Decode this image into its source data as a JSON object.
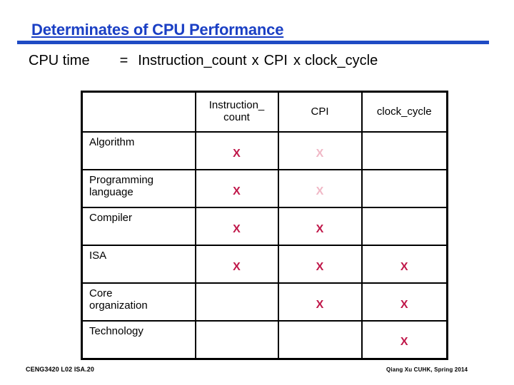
{
  "slide": {
    "title": "Determinates of CPU Performance",
    "title_color": "#1a3fc4",
    "rule_color": "#1f4bc4"
  },
  "formula": {
    "lhs": "CPU time",
    "equals": "=",
    "term1": "Instruction_count",
    "operator1": "x",
    "term2": "CPI",
    "operator2": "x",
    "term3": "clock_cycle"
  },
  "table": {
    "mark_color": "#c0184a",
    "mark_faded_color": "#f0b8c6",
    "corner_label": "",
    "columns": [
      {
        "key": "factor",
        "label": ""
      },
      {
        "key": "instruction_count",
        "label": "Instruction_\ncount"
      },
      {
        "key": "cpi",
        "label": "CPI"
      },
      {
        "key": "clock_cycle",
        "label": "clock_cycle"
      }
    ],
    "column_labels_display": {
      "c1_line1": "Instruction_",
      "c1_line2": "count",
      "c2": "CPI",
      "c3": "clock_cycle"
    },
    "rows": [
      {
        "label": "Algorithm",
        "label_line1": "Algorithm",
        "label_line2": "",
        "cells": [
          {
            "mark": "X",
            "state": "on"
          },
          {
            "mark": "X",
            "state": "faded"
          },
          {
            "mark": "",
            "state": "off"
          }
        ]
      },
      {
        "label": "Programming language",
        "label_line1": "Programming",
        "label_line2": "language",
        "cells": [
          {
            "mark": "X",
            "state": "on"
          },
          {
            "mark": "X",
            "state": "faded"
          },
          {
            "mark": "",
            "state": "off"
          }
        ]
      },
      {
        "label": "Compiler",
        "label_line1": "Compiler",
        "label_line2": "",
        "cells": [
          {
            "mark": "X",
            "state": "on"
          },
          {
            "mark": "X",
            "state": "on"
          },
          {
            "mark": "",
            "state": "off"
          }
        ]
      },
      {
        "label": "ISA",
        "label_line1": "ISA",
        "label_line2": "",
        "cells": [
          {
            "mark": "X",
            "state": "on"
          },
          {
            "mark": "X",
            "state": "on"
          },
          {
            "mark": "X",
            "state": "on"
          }
        ]
      },
      {
        "label": "Core organization",
        "label_line1": "Core",
        "label_line2": "organization",
        "cells": [
          {
            "mark": "",
            "state": "off"
          },
          {
            "mark": "X",
            "state": "on"
          },
          {
            "mark": "X",
            "state": "on"
          }
        ]
      },
      {
        "label": "Technology",
        "label_line1": "Technology",
        "label_line2": "",
        "cells": [
          {
            "mark": "",
            "state": "off"
          },
          {
            "mark": "",
            "state": "off"
          },
          {
            "mark": "X",
            "state": "on"
          }
        ]
      }
    ]
  },
  "footer": {
    "left": "CENG3420 L02 ISA.20",
    "right": "Qiang Xu  CUHK, Spring 2014"
  }
}
